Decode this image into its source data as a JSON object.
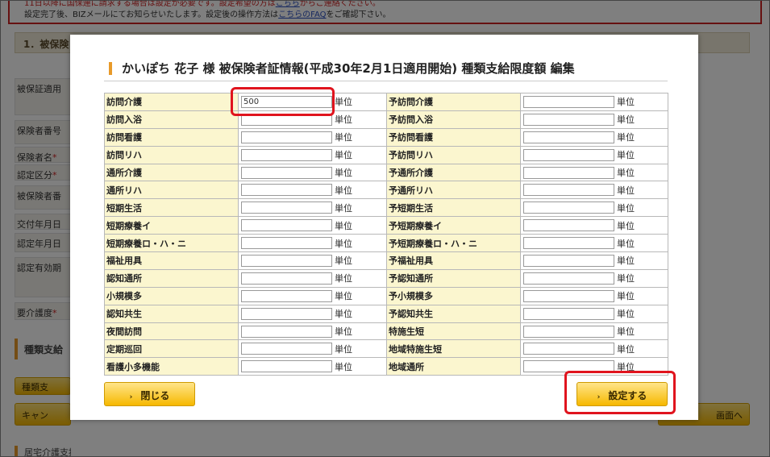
{
  "background": {
    "notice_line1": "11日以降に国保連に請求する場合は設定が必要です。設定希望の方は",
    "notice_line1_link": "こちら",
    "notice_line1_tail": "からご連絡ください。",
    "notice_line2": "設定完了後、BIZメールにてお知らせいたします。設定後の操作方法は",
    "notice_line2_link": "こちらのFAQ",
    "notice_line2_tail": "をご確認下さい。",
    "section_title": "1．被保険",
    "labels": [
      {
        "text": "被保証適用"
      },
      {
        "text": "保険者番号"
      },
      {
        "text": "保険者名",
        "req": "*"
      },
      {
        "text": "認定区分",
        "req": "*"
      },
      {
        "text": "被保険者番"
      },
      {
        "text": "交付年月日"
      },
      {
        "text": "認定年月日"
      },
      {
        "text": "認定有効期"
      },
      {
        "text": "要介護度",
        "req": "*"
      }
    ],
    "sub_section_title": "種類支給",
    "type_button": "種類支",
    "cancel_button": "キャン",
    "next_button": "画面へ",
    "bottom_section_title": "居宅介護支援事業所"
  },
  "modal": {
    "title": "かいぽち 花子 様 被保険者証情報(平成30年2月1日適用開始) 種類支給限度額 編集",
    "unit": "単位",
    "rows": [
      {
        "left": "訪問介護",
        "left_value": "500",
        "right": "予訪問介護",
        "right_value": ""
      },
      {
        "left": "訪問入浴",
        "left_value": "",
        "right": "予訪問入浴",
        "right_value": ""
      },
      {
        "left": "訪問看護",
        "left_value": "",
        "right": "予訪問看護",
        "right_value": ""
      },
      {
        "left": "訪問リハ",
        "left_value": "",
        "right": "予訪問リハ",
        "right_value": ""
      },
      {
        "left": "通所介護",
        "left_value": "",
        "right": "予通所介護",
        "right_value": ""
      },
      {
        "left": "通所リハ",
        "left_value": "",
        "right": "予通所リハ",
        "right_value": ""
      },
      {
        "left": "短期生活",
        "left_value": "",
        "right": "予短期生活",
        "right_value": ""
      },
      {
        "left": "短期療養イ",
        "left_value": "",
        "right": "予短期療養イ",
        "right_value": ""
      },
      {
        "left": "短期療養ロ・ハ・ニ",
        "left_value": "",
        "right": "予短期療養ロ・ハ・ニ",
        "right_value": ""
      },
      {
        "left": "福祉用具",
        "left_value": "",
        "right": "予福祉用具",
        "right_value": ""
      },
      {
        "left": "認知通所",
        "left_value": "",
        "right": "予認知通所",
        "right_value": ""
      },
      {
        "left": "小規模多",
        "left_value": "",
        "right": "予小規模多",
        "right_value": ""
      },
      {
        "left": "認知共生",
        "left_value": "",
        "right": "予認知共生",
        "right_value": ""
      },
      {
        "left": "夜間訪問",
        "left_value": "",
        "right": "特施生短",
        "right_value": ""
      },
      {
        "left": "定期巡回",
        "left_value": "",
        "right": "地域特施生短",
        "right_value": ""
      },
      {
        "left": "看護小多機能",
        "left_value": "",
        "right": "地域通所",
        "right_value": ""
      }
    ],
    "close_button": "閉じる",
    "set_button": "設定する"
  },
  "colors": {
    "accent_orange": "#e89a2a",
    "label_bg": "#fbf6cf",
    "button_yellow": "#f6b800",
    "highlight_red": "#e0141e"
  }
}
